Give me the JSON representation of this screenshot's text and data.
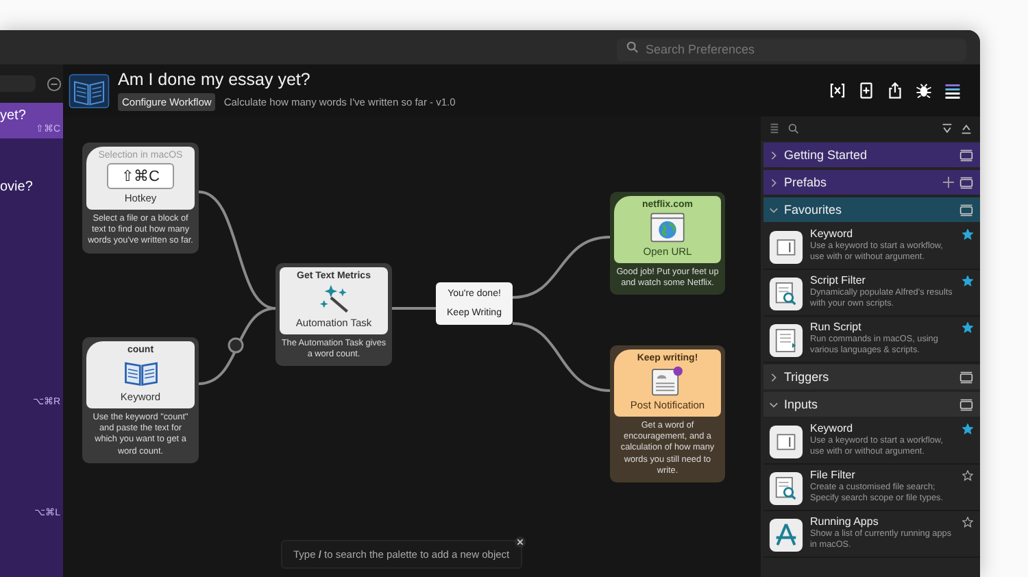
{
  "window": {
    "search_placeholder": "Search Preferences"
  },
  "sidebar": {
    "items": [
      {
        "title": "yet?",
        "shortcut": "⇧⌘C",
        "selected": true
      },
      {
        "title": "ovie?",
        "selected": false
      },
      {
        "shortcut": "⌥⌘R",
        "selected": false
      },
      {
        "shortcut": "⌥⌘L",
        "selected": false
      }
    ]
  },
  "workflow": {
    "title": "Am I done my essay yet?",
    "configure_button": "Configure Workflow",
    "subtitle": "Calculate how many words I've written so far - v1.0"
  },
  "canvas": {
    "nodes": [
      {
        "kind": "hotkey",
        "caption": "Selection in macOS",
        "key": "⇧⌘C",
        "title": "Hotkey",
        "description": "Select a file or a block of text to find out how many words you've written so far."
      },
      {
        "kind": "keyword",
        "caption": "count",
        "title": "Keyword",
        "description": "Use the keyword \"count\" and paste the text for which you want to get a word count."
      },
      {
        "kind": "automation",
        "caption": "Get Text Metrics",
        "title": "Automation Task",
        "description": "The Automation Task gives a word count."
      },
      {
        "kind": "conditional",
        "branches": [
          "You're done!",
          "Keep Writing"
        ]
      },
      {
        "kind": "open_url",
        "caption": "netflix.com",
        "title": "Open URL",
        "description": "Good job! Put your feet up and watch some Netflix."
      },
      {
        "kind": "notification",
        "caption": "Keep writing!",
        "title": "Post Notification",
        "description": "Get a word of encouragement, and a calculation of how many words you still need to write."
      }
    ],
    "hint": "Type **/** to search the palette to add a new object"
  },
  "palette": {
    "sections": [
      {
        "title": "Getting Started",
        "color": "#3b2a6b",
        "expanded": false,
        "addable": false
      },
      {
        "title": "Prefabs",
        "color": "#3b2a6b",
        "expanded": false,
        "addable": true
      },
      {
        "title": "Favourites",
        "color": "#1d4a5c",
        "expanded": true,
        "addable": false,
        "items": [
          {
            "kind": "keyword",
            "title": "Keyword",
            "description": "Use a keyword to start a workflow, use with or without argument.",
            "starred": true
          },
          {
            "kind": "script_filter",
            "title": "Script Filter",
            "description": "Dynamically populate Alfred's results with your own scripts.",
            "starred": true
          },
          {
            "kind": "run_script",
            "title": "Run Script",
            "description": "Run commands in macOS, using various languages & scripts.",
            "starred": true
          }
        ]
      },
      {
        "title": "Triggers",
        "color": "#303030",
        "expanded": false,
        "addable": false
      },
      {
        "title": "Inputs",
        "color": "#303030",
        "expanded": true,
        "addable": false,
        "items": [
          {
            "kind": "keyword",
            "title": "Keyword",
            "description": "Use a keyword to start a workflow, use with or without argument.",
            "starred": true
          },
          {
            "kind": "file_filter",
            "title": "File Filter",
            "description": "Create a customised file search; Specify search scope or file types.",
            "starred": false
          },
          {
            "kind": "apps",
            "title": "Running Apps",
            "description": "Show a list of currently running apps in macOS.",
            "starred": false
          }
        ]
      }
    ]
  }
}
